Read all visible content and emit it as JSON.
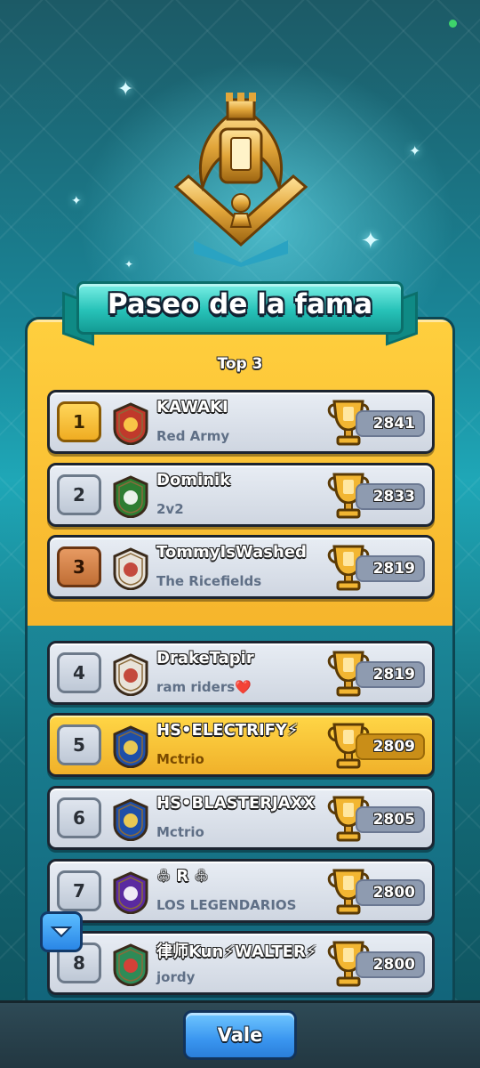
{
  "header": {
    "title": "Paseo de la fama",
    "subtitle": "Top 3"
  },
  "players": [
    {
      "rank": "1",
      "name": "KAWAKI",
      "clan": "Red Army",
      "trophies": "2841",
      "badge_icon": "crown-badge-icon",
      "rank_style": "gold"
    },
    {
      "rank": "2",
      "name": "Dominik",
      "clan": "2v2",
      "trophies": "2833",
      "badge_icon": "cross-badge-icon",
      "rank_style": "silver"
    },
    {
      "rank": "3",
      "name": "TommyIsWashed",
      "clan": "The Ricefields",
      "trophies": "2819",
      "badge_icon": "mountain-sun-badge-icon",
      "rank_style": "bronze"
    },
    {
      "rank": "4",
      "name": "DrakeTapir",
      "clan": "ram riders❤️",
      "trophies": "2819",
      "badge_icon": "mountain-sun-badge-icon",
      "rank_style": "silver"
    },
    {
      "rank": "5",
      "name": "HS•ELECTRIFY⚡",
      "clan": "Mctrio",
      "trophies": "2809",
      "badge_icon": "star-badge-icon",
      "rank_style": "silver",
      "highlight": true
    },
    {
      "rank": "6",
      "name": "HS•BLASTERJAXX",
      "clan": "Mctrio",
      "trophies": "2805",
      "badge_icon": "star-badge-icon",
      "rank_style": "silver"
    },
    {
      "rank": "7",
      "name": "♧    R    ♧",
      "clan": "LOS LEGENDARIOS",
      "trophies": "2800",
      "badge_icon": "starburst-badge-icon",
      "rank_style": "silver"
    },
    {
      "rank": "8",
      "name": "律师Kun⚡WALTER⚡",
      "clan": "jordy",
      "trophies": "2800",
      "badge_icon": "compass-badge-icon",
      "rank_style": "silver"
    }
  ],
  "footer": {
    "button_label": "Vale"
  },
  "colors": {
    "gold": "#f6b52c",
    "teal": "#1b8697",
    "button_blue": "#3a96f0"
  }
}
